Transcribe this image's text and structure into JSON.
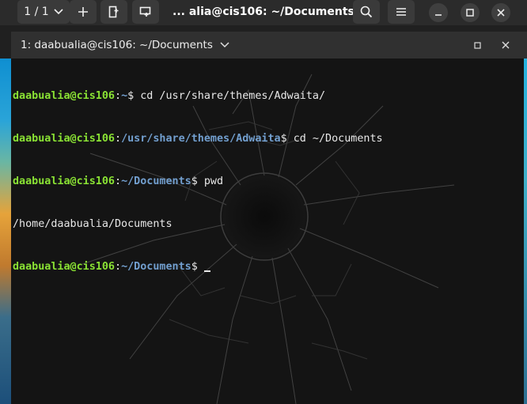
{
  "headerbar": {
    "tab_counter": "1 / 1",
    "title": "... alia@cis106: ~/Documents",
    "icons": {
      "tab_menu": "chevron-down-icon",
      "new_tab": "plus-icon",
      "new_terminal": "new-terminal-icon",
      "new_window": "new-window-icon",
      "search": "search-icon",
      "menu": "hamburger-menu-icon",
      "minimize": "minimize-icon",
      "maximize": "maximize-icon",
      "close": "close-icon"
    }
  },
  "tab": {
    "label": "1: daabualia@cis106: ~/Documents",
    "icons": {
      "dropdown": "chevron-down-icon",
      "maximize": "maximize-icon",
      "close": "close-icon"
    }
  },
  "terminal": {
    "lines": [
      {
        "user": "daabualia@cis106",
        "sep": ":",
        "path": "~",
        "prompt": "$ ",
        "cmd": "cd /usr/share/themes/Adwaita/"
      },
      {
        "user": "daabualia@cis106",
        "sep": ":",
        "path": "/usr/share/themes/Adwaita",
        "prompt": "$ ",
        "cmd": "cd ~/Documents"
      },
      {
        "user": "daabualia@cis106",
        "sep": ":",
        "path": "~/Documents",
        "prompt": "$ ",
        "cmd": "pwd"
      },
      {
        "output": "/home/daabualia/Documents"
      },
      {
        "user": "daabualia@cis106",
        "sep": ":",
        "path": "~/Documents",
        "prompt": "$ ",
        "cmd": ""
      }
    ],
    "colors": {
      "user": "#8ae234",
      "path": "#729fcf",
      "text": "#e8e8e8",
      "background": "#141414"
    }
  }
}
